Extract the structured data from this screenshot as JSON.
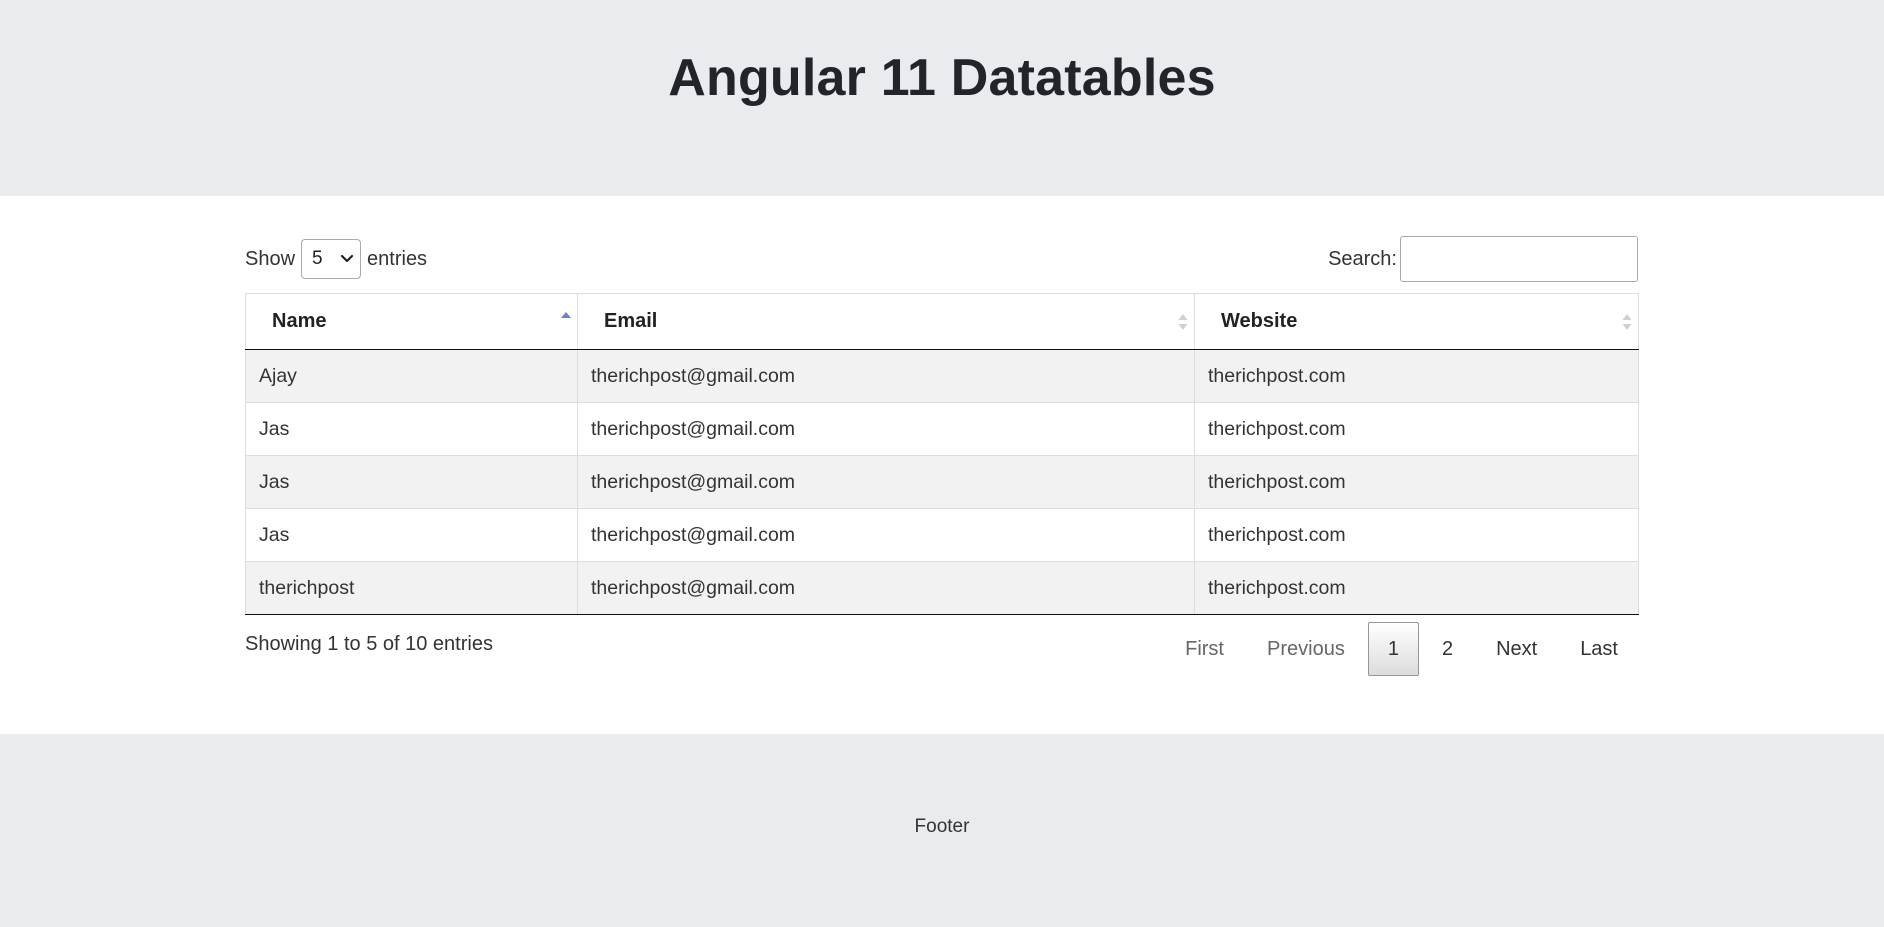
{
  "header": {
    "title": "Angular 11 Datatables"
  },
  "length_menu": {
    "prefix": "Show",
    "selected": "5",
    "suffix": "entries"
  },
  "search": {
    "label": "Search:",
    "value": ""
  },
  "table": {
    "columns": [
      {
        "label": "Name",
        "sort": "ascending"
      },
      {
        "label": "Email",
        "sort": "none"
      },
      {
        "label": "Website",
        "sort": "none"
      }
    ],
    "rows": [
      [
        "Ajay",
        "therichpost@gmail.com",
        "therichpost.com"
      ],
      [
        "Jas",
        "therichpost@gmail.com",
        "therichpost.com"
      ],
      [
        "Jas",
        "therichpost@gmail.com",
        "therichpost.com"
      ],
      [
        "Jas",
        "therichpost@gmail.com",
        "therichpost.com"
      ],
      [
        "therichpost",
        "therichpost@gmail.com",
        "therichpost.com"
      ]
    ]
  },
  "info": "Showing 1 to 5 of 10 entries",
  "pagination": {
    "first": "First",
    "previous": "Previous",
    "pages": [
      "1",
      "2"
    ],
    "current_page": "1",
    "next": "Next",
    "last": "Last"
  },
  "footer": {
    "text": "Footer"
  },
  "colors": {
    "band_background": "#e9ecef",
    "sort_active": "#6b7fd7",
    "sort_inactive": "#d0d0d0"
  }
}
